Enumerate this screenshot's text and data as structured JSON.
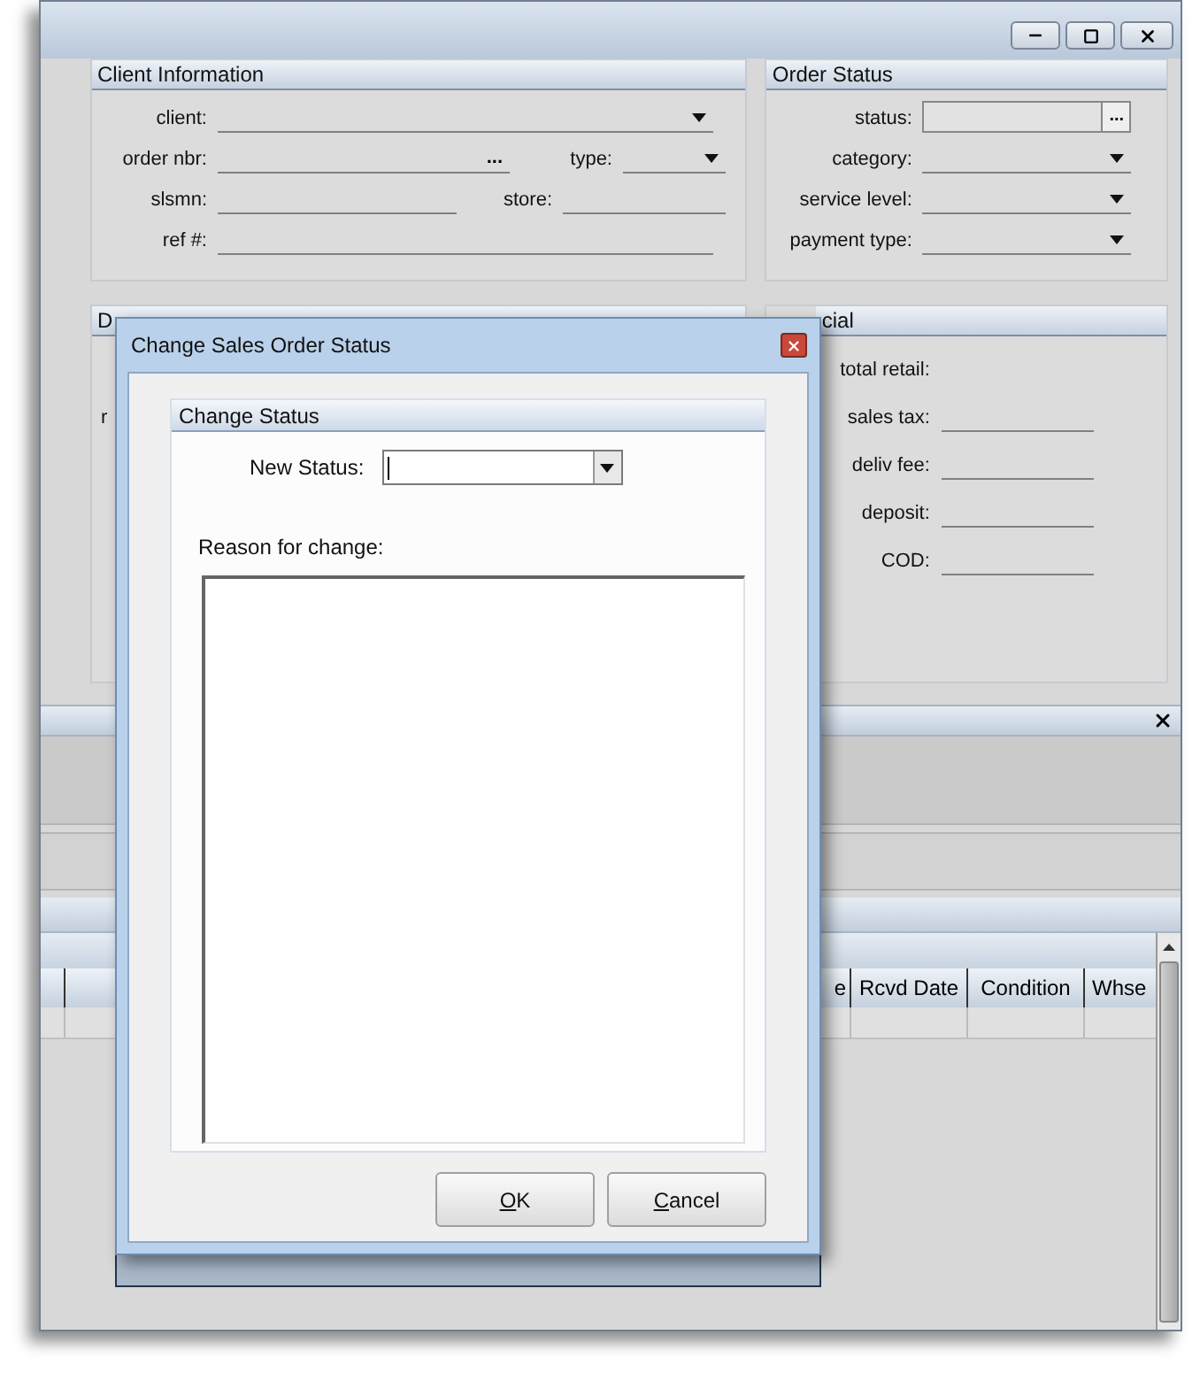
{
  "client_information": {
    "title": "Client Information",
    "rows": [
      [
        {
          "label": "client:",
          "kind": "dropdown"
        }
      ],
      [
        {
          "label": "order nbr:",
          "kind": "lookup",
          "button": "..."
        },
        {
          "label": "type:",
          "kind": "dropdown"
        }
      ],
      [
        {
          "label": "slsmn:",
          "kind": "text"
        },
        {
          "label": "store:",
          "kind": "text"
        }
      ],
      [
        {
          "label": "ref #:",
          "kind": "text"
        }
      ]
    ]
  },
  "order_status": {
    "title": "Order Status",
    "fields": [
      {
        "label": "status:",
        "kind": "lookup_box",
        "button": "..."
      },
      {
        "label": "category:",
        "kind": "dropdown"
      },
      {
        "label": "service level:",
        "kind": "dropdown"
      },
      {
        "label": "payment type:",
        "kind": "dropdown"
      }
    ]
  },
  "delivery": {
    "title": "D",
    "fields": [
      {
        "label": "r"
      }
    ]
  },
  "financial": {
    "title": "cial",
    "fields": [
      {
        "label": "total retail:",
        "kind": "label"
      },
      {
        "label": "sales tax:",
        "kind": "text"
      },
      {
        "label": "deliv fee:",
        "kind": "text"
      },
      {
        "label": "deposit:",
        "kind": "text"
      },
      {
        "label": "COD:",
        "kind": "text"
      }
    ]
  },
  "table": {
    "columns": [
      "e",
      "Rcvd Date",
      "Condition",
      "Whse"
    ]
  },
  "dialog": {
    "title": "Change Sales Order Status",
    "group_title": "Change Status",
    "new_status": {
      "label": "New Status:"
    },
    "reason": {
      "label": "Reason for change:"
    },
    "buttons": [
      {
        "label": "OK",
        "underline_first": true
      },
      {
        "label": "Cancel",
        "underline_first": true
      }
    ]
  }
}
